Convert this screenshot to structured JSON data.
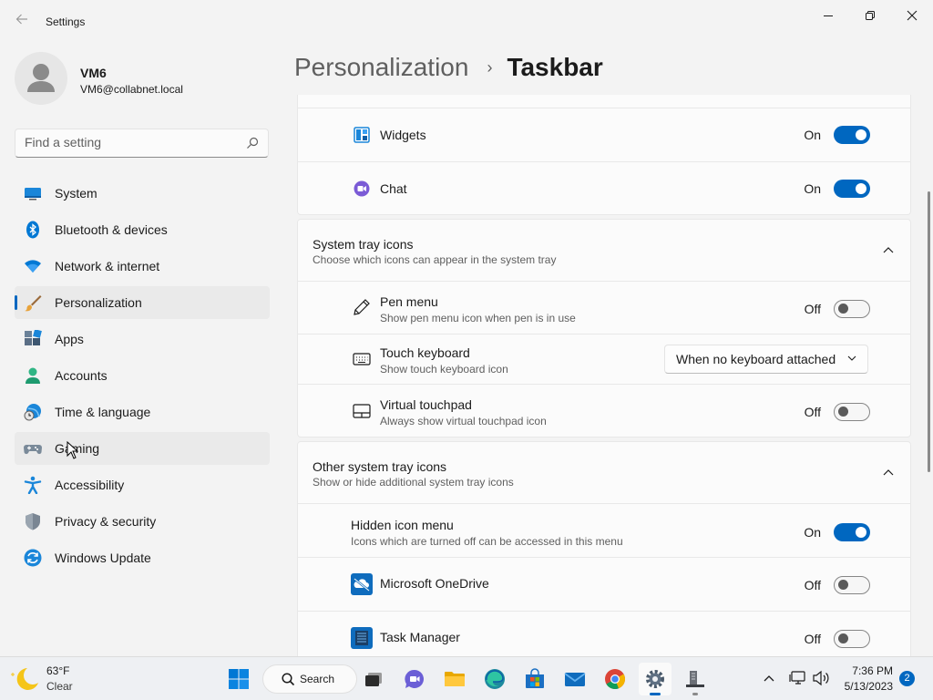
{
  "window": {
    "title": "Settings",
    "controls": [
      "minimize-icon",
      "restore-icon",
      "close-icon"
    ]
  },
  "profile": {
    "name": "VM6",
    "email": "VM6@collabnet.local"
  },
  "search": {
    "placeholder": "Find a setting"
  },
  "nav": {
    "items": [
      {
        "label": "System",
        "icon": "monitor-icon"
      },
      {
        "label": "Bluetooth & devices",
        "icon": "bluetooth-icon"
      },
      {
        "label": "Network & internet",
        "icon": "wifi-icon"
      },
      {
        "label": "Personalization",
        "icon": "brush-icon",
        "selected": true
      },
      {
        "label": "Apps",
        "icon": "apps-icon"
      },
      {
        "label": "Accounts",
        "icon": "person-icon"
      },
      {
        "label": "Time & language",
        "icon": "globe-clock-icon"
      },
      {
        "label": "Gaming",
        "icon": "gamepad-icon",
        "hover": true
      },
      {
        "label": "Accessibility",
        "icon": "accessibility-icon"
      },
      {
        "label": "Privacy & security",
        "icon": "shield-icon"
      },
      {
        "label": "Windows Update",
        "icon": "update-icon"
      }
    ]
  },
  "header": {
    "breadcrumb_parent": "Personalization",
    "separator": "›",
    "current": "Taskbar"
  },
  "taskbar_items_card": {
    "rows": [
      {
        "title": "Widgets",
        "state": "On",
        "icon": "widgets-icon"
      },
      {
        "title": "Chat",
        "state": "On",
        "icon": "chat-icon"
      }
    ]
  },
  "system_tray_section": {
    "title": "System tray icons",
    "subtitle": "Choose which icons can appear in the system tray",
    "rows": [
      {
        "title": "Pen menu",
        "subtitle": "Show pen menu icon when pen is in use",
        "state": "Off",
        "icon": "pen-icon"
      },
      {
        "title": "Touch keyboard",
        "subtitle": "Show touch keyboard icon",
        "dropdown": "When no keyboard attached",
        "icon": "keyboard-icon"
      },
      {
        "title": "Virtual touchpad",
        "subtitle": "Always show virtual touchpad icon",
        "state": "Off",
        "icon": "touchpad-icon"
      }
    ]
  },
  "other_tray_section": {
    "title": "Other system tray icons",
    "subtitle": "Show or hide additional system tray icons",
    "rows": [
      {
        "title": "Hidden icon menu",
        "subtitle": "Icons which are turned off can be accessed in this menu",
        "state": "On"
      },
      {
        "title": "Microsoft OneDrive",
        "state": "Off",
        "icon": "onedrive-icon"
      },
      {
        "title": "Task Manager",
        "state": "Off",
        "icon": "task-manager-icon"
      }
    ]
  },
  "taskbar": {
    "weather": {
      "temp": "63°F",
      "desc": "Clear"
    },
    "search_label": "Search",
    "clock": {
      "time": "7:36 PM",
      "date": "5/13/2023"
    },
    "notification_count": "2",
    "apps": [
      "start-icon",
      "search-icon",
      "task-view-icon",
      "teams-chat-icon",
      "file-explorer-icon",
      "edge-icon",
      "store-icon",
      "mail-icon",
      "chrome-icon",
      "settings-icon",
      "server-manager-icon"
    ]
  },
  "colors": {
    "accent": "#0067c0",
    "background": "#f3f3f3",
    "card": "#fbfbfb"
  }
}
